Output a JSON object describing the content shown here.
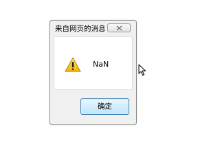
{
  "dialog": {
    "title": "来自网页的消息",
    "message": "NaN",
    "ok_label": "确定",
    "icons": {
      "close": "close-icon",
      "message": "warning-icon"
    }
  },
  "colors": {
    "warning_yellow": "#f4c21b",
    "button_border": "#3c7fb1",
    "button_fill": "#bee6fd",
    "dialog_frame": "#f0f0f0"
  }
}
